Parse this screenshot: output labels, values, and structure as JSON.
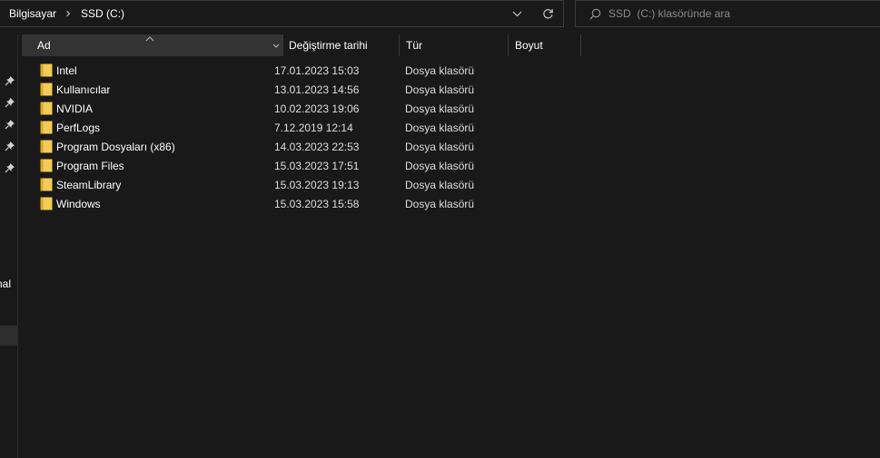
{
  "address_bar": {
    "breadcrumbs": [
      "Bilgisayar",
      "SSD  (C:)"
    ],
    "separator_icon": "chevron-right-icon",
    "dropdown_icon": "chevron-down-icon",
    "refresh_icon": "refresh-icon"
  },
  "search": {
    "placeholder": "SSD  (C:) klasöründe ara",
    "icon": "search-icon"
  },
  "nav_pane": {
    "pin_icons": 5,
    "clipped_label": "rnal"
  },
  "columns": {
    "name": "Ad",
    "date": "Değiştirme tarihi",
    "type": "Tür",
    "size": "Boyut",
    "sort_icon": "sort-up-icon"
  },
  "files": [
    {
      "name": "Intel",
      "date": "17.01.2023 15:03",
      "type": "Dosya klasörü"
    },
    {
      "name": "Kullanıcılar",
      "date": "13.01.2023 14:56",
      "type": "Dosya klasörü"
    },
    {
      "name": "NVIDIA",
      "date": "10.02.2023 19:06",
      "type": "Dosya klasörü"
    },
    {
      "name": "PerfLogs",
      "date": "7.12.2019 12:14",
      "type": "Dosya klasörü"
    },
    {
      "name": "Program Dosyaları (x86)",
      "date": "14.03.2023 22:53",
      "type": "Dosya klasörü"
    },
    {
      "name": "Program Files",
      "date": "15.03.2023 17:51",
      "type": "Dosya klasörü"
    },
    {
      "name": "SteamLibrary",
      "date": "15.03.2023 19:13",
      "type": "Dosya klasörü"
    },
    {
      "name": "Windows",
      "date": "15.03.2023 15:58",
      "type": "Dosya klasörü"
    }
  ],
  "colors": {
    "background": "#191919",
    "header_active": "#333333",
    "folder": "#f3cc56",
    "border": "#3a3a3a"
  }
}
